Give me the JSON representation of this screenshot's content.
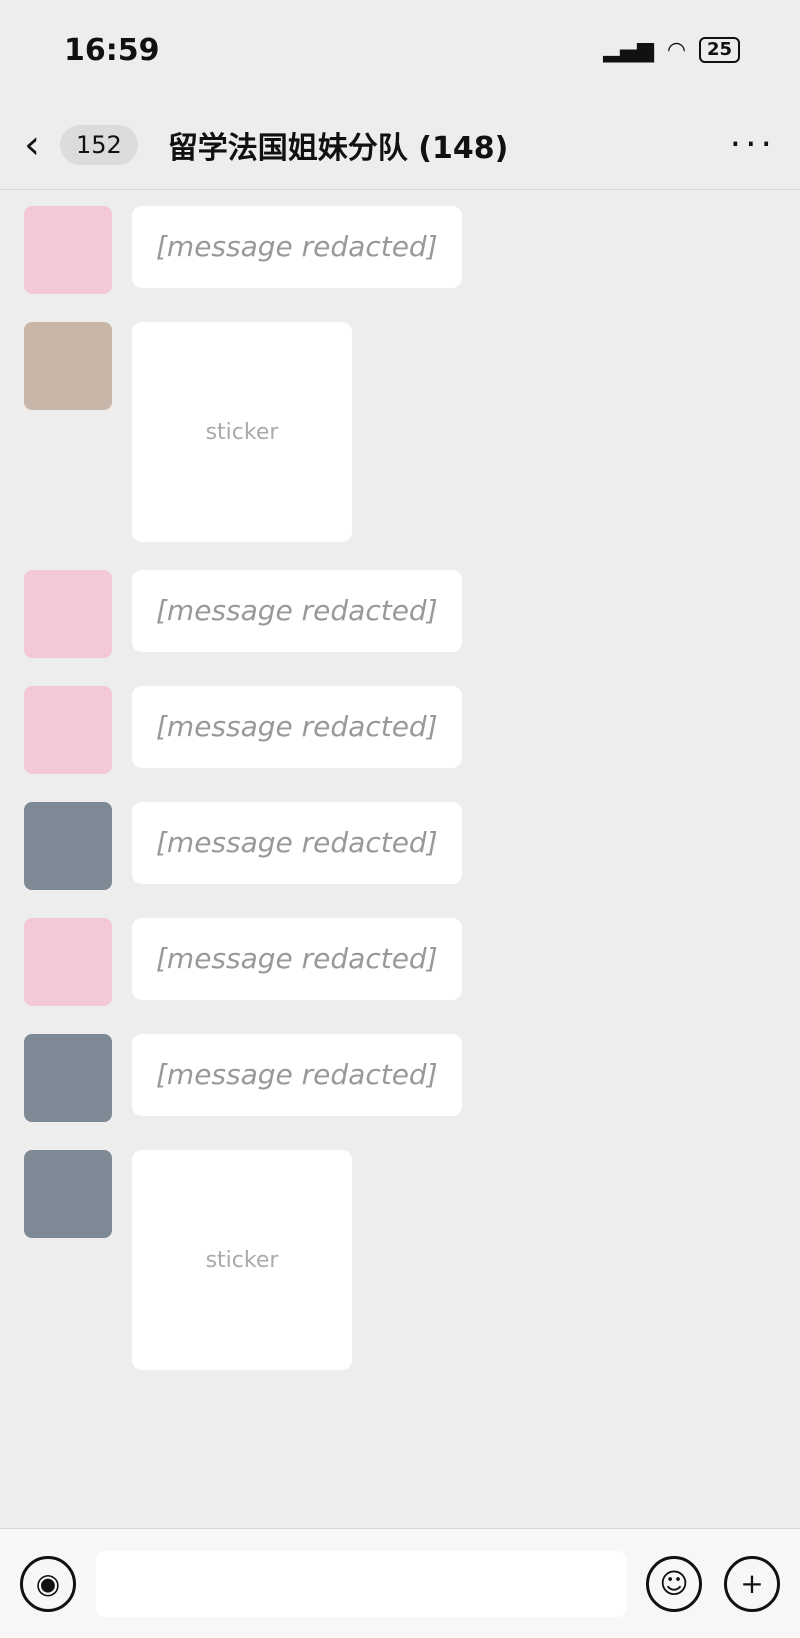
{
  "status_bar": {
    "time": "16:59",
    "battery": "25"
  },
  "nav": {
    "back_count": "152",
    "title": "留学法国姐妹分队 (148)"
  },
  "messages": [
    {
      "type": "text",
      "text": "[message redacted]"
    },
    {
      "type": "sticker"
    },
    {
      "type": "text",
      "text": "[message redacted]"
    },
    {
      "type": "text",
      "text": "[message redacted]"
    },
    {
      "type": "text",
      "text": "[message redacted]"
    },
    {
      "type": "text",
      "text": "[message redacted]"
    },
    {
      "type": "text",
      "text": "[message redacted]"
    },
    {
      "type": "sticker"
    }
  ]
}
